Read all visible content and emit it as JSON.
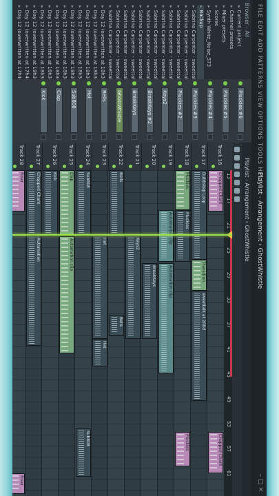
{
  "window": {
    "menu": "FILE EDIT ADD PATTERNS VIEW OPTIONS TOOLS HELP",
    "title": "Playlist - Arrangement › GhostWhistle",
    "controls": "– ▢ ×"
  },
  "browser": {
    "header": "Browser - All",
    "items": [
      {
        "label": "Current project",
        "selected": false
      },
      {
        "label": "Channel presets",
        "selected": false
      },
      {
        "label": "Mixer presets",
        "selected": false
      },
      {
        "label": "Scores",
        "selected": false
      },
      {
        "label": "Synth White_Noise_573",
        "selected": false
      },
      {
        "label": "Backup",
        "selected": true
      },
      {
        "label": "Sabrina Carpenter - sweettalk at 200d",
        "selected": false
      },
      {
        "label": "Sabrina Carpenter - sweettalk at 200d",
        "selected": false
      },
      {
        "label": "Sabrina Carpenter - sweettalk at 200d",
        "selected": false
      },
      {
        "label": "Sabrina Carpenter - sweettalk at 200d",
        "selected": false
      },
      {
        "label": "Sabrina Carpenter - sweettalk at 200d",
        "selected": false
      },
      {
        "label": "Sabrina Carpenter - sweettalk at 200d",
        "selected": false
      },
      {
        "label": "Sabrina Carpenter - sweettalk at 200d",
        "selected": false
      },
      {
        "label": "Sabrina Carpenter - sweettalk at 200d",
        "selected": false
      },
      {
        "label": "Sabrina Carpenter - sweettalk at 200d",
        "selected": false
      },
      {
        "label": "Sabrina Carpenter - sweettalk at 200d",
        "selected": false
      },
      {
        "label": "Sabrina Carpenter - sweettalk at 200d",
        "selected": false
      },
      {
        "label": "Sabrina Carpenter - sweettalk at 200d",
        "selected": false
      },
      {
        "label": "Day 12 (overwritten at 18h34)",
        "selected": false
      },
      {
        "label": "Day 12 (overwritten at 18h34)",
        "selected": false
      },
      {
        "label": "Day 12 (overwritten at 18h34)",
        "selected": false
      },
      {
        "label": "Day 12 (overwritten at 18h34)",
        "selected": false
      },
      {
        "label": "Day 12 (overwritten at 18h34)",
        "selected": false
      },
      {
        "label": "Day 12 (overwritten at 18h34)",
        "selected": false
      },
      {
        "label": "Day 12 (overwritten at 18h34)",
        "selected": false
      },
      {
        "label": "Day 12 (overwritten at 18h34)",
        "selected": false
      },
      {
        "label": "Day 12 (overwritten at 18h34)",
        "selected": false
      },
      {
        "label": "Day 12 (overwritten at 18h34)",
        "selected": false
      },
      {
        "label": "Day 12 (overwritten at 17h49)",
        "selected": false
      },
      {
        "label": "Day 12 (overwritten at 17h49)",
        "selected": false
      }
    ]
  },
  "rack": {
    "channels": [
      {
        "label": "Pluckies #6"
      },
      {
        "label": "Pluckies #5"
      },
      {
        "label": "Pluckies #4"
      },
      {
        "label": "Pluckies #3"
      },
      {
        "label": "Pluckies #2"
      },
      {
        "label": "Keys2"
      },
      {
        "label": "BreakKeys #2"
      },
      {
        "label": "BreakKeys"
      },
      {
        "label": "GhostWhistle",
        "active": true
      },
      {
        "label": "Bells"
      },
      {
        "label": "Hat"
      },
      {
        "label": "Sub808"
      },
      {
        "label": "Clap"
      },
      {
        "label": "Kick"
      }
    ]
  },
  "playlist": {
    "title": "Playlist - Arrangement › GhostWhistle",
    "ruler": [
      "13",
      "17",
      "21",
      "25",
      "29",
      "33",
      "37",
      "41",
      "45",
      "49",
      "53",
      "57",
      "61"
    ],
    "tracks": [
      {
        "label": "Track 16"
      },
      {
        "label": "Track 17"
      },
      {
        "label": "Track 18"
      },
      {
        "label": "Track 19"
      },
      {
        "label": "Track 20"
      },
      {
        "label": "Track 21"
      },
      {
        "label": "Track 22"
      },
      {
        "label": "Track 23"
      },
      {
        "label": "Track 24"
      },
      {
        "label": "Track 25"
      },
      {
        "label": "Track 26"
      },
      {
        "label": "Track 27"
      },
      {
        "label": "Track 28"
      }
    ],
    "clips": [
      {
        "track": 0,
        "start": 0,
        "len": 60,
        "label": "Chopped Chant",
        "kind": "pink"
      },
      {
        "track": 0,
        "start": 380,
        "len": 60,
        "label": "Chopped Chant",
        "kind": "pink"
      },
      {
        "track": 1,
        "start": 0,
        "len": 130,
        "label": "Dubbstep Loop",
        "kind": "audio"
      },
      {
        "track": 1,
        "start": 130,
        "len": 45,
        "label": "Transition",
        "kind": "green"
      },
      {
        "track": 1,
        "start": 175,
        "len": 160,
        "label": "sweettalk at 200d",
        "kind": "audio"
      },
      {
        "track": 2,
        "start": 0,
        "len": 58,
        "label": "Pluckies",
        "kind": "green"
      },
      {
        "track": 2,
        "start": 58,
        "len": 75,
        "label": "Pluckies",
        "kind": "audio"
      },
      {
        "track": 2,
        "start": 380,
        "len": 50,
        "label": "Pluckies",
        "kind": "pink"
      },
      {
        "track": 3,
        "start": 58,
        "len": 75,
        "label": "Automation clip",
        "kind": "teal"
      },
      {
        "track": 3,
        "start": 135,
        "len": 160,
        "label": "Automation clip",
        "kind": "teal"
      },
      {
        "track": 4,
        "start": 135,
        "len": 110,
        "label": "BreakKeys",
        "kind": "audio"
      },
      {
        "track": 5,
        "start": 95,
        "len": 150,
        "label": "Keys2",
        "kind": "audio"
      },
      {
        "track": 6,
        "start": 0,
        "len": 95,
        "label": "Bells",
        "kind": "audio"
      },
      {
        "track": 6,
        "start": 210,
        "len": 30,
        "label": "Bells",
        "kind": "audio"
      },
      {
        "track": 7,
        "start": 95,
        "len": 150,
        "label": "Hat",
        "kind": "audio"
      },
      {
        "track": 7,
        "start": 245,
        "len": 40,
        "label": "Hat",
        "kind": "audio"
      },
      {
        "track": 8,
        "start": 0,
        "len": 96,
        "label": "Sub808",
        "kind": "audio"
      },
      {
        "track": 8,
        "start": 375,
        "len": 70,
        "label": "Sub808",
        "kind": "audio"
      },
      {
        "track": 9,
        "start": 0,
        "len": 96,
        "label": "Clap",
        "kind": "green"
      },
      {
        "track": 9,
        "start": 96,
        "len": 170,
        "label": "Automation clip",
        "kind": "green"
      },
      {
        "track": 10,
        "start": 0,
        "len": 96,
        "label": "Kick",
        "kind": "audio"
      },
      {
        "track": 11,
        "start": 0,
        "len": 95,
        "label": "Chopped Chant",
        "kind": "audio"
      },
      {
        "track": 11,
        "start": 95,
        "len": 160,
        "label": "Automation",
        "kind": "audio"
      },
      {
        "track": 12,
        "start": 0,
        "len": 60,
        "label": "Riser",
        "kind": "pink"
      },
      {
        "track": 12,
        "start": 440,
        "len": 30,
        "label": "Riser",
        "kind": "pink"
      }
    ]
  }
}
